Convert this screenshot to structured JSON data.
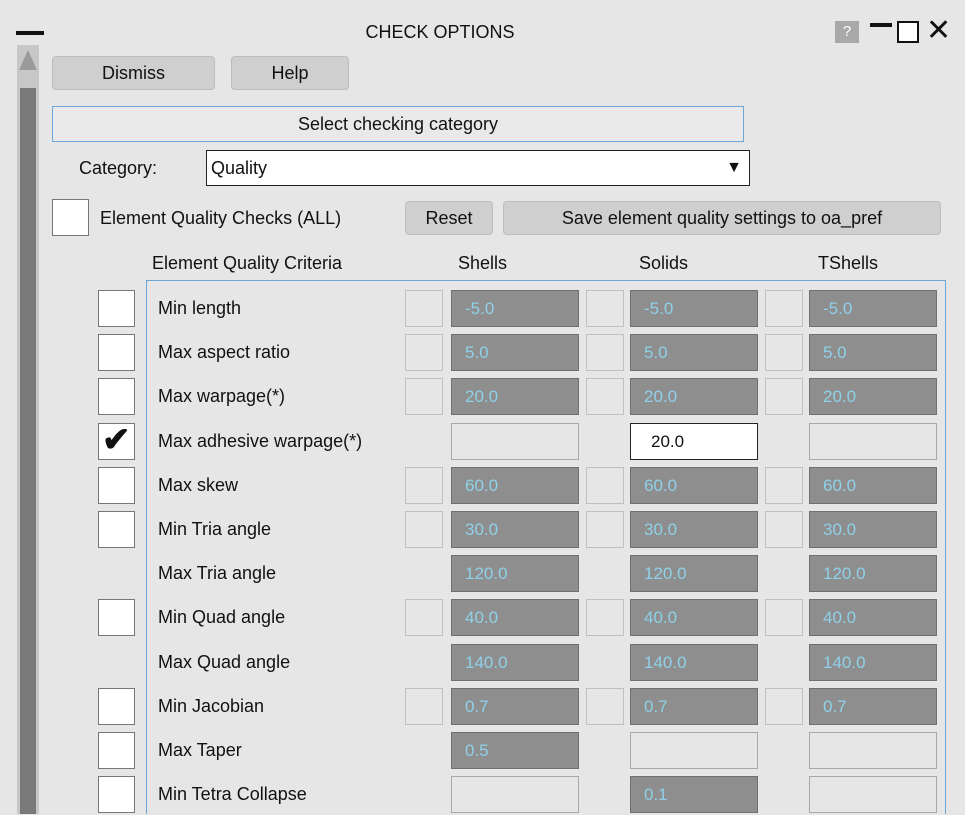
{
  "window": {
    "title": "CHECK OPTIONS",
    "help": "?"
  },
  "toolbar": {
    "dismiss": "Dismiss",
    "help": "Help"
  },
  "category": {
    "banner": "Select checking category",
    "label": "Category:",
    "value": "Quality"
  },
  "quality": {
    "all_label": "Element Quality Checks (ALL)",
    "reset": "Reset",
    "save": "Save element quality settings to oa_pref"
  },
  "columns": {
    "criteria": "Element Quality Criteria",
    "shells": "Shells",
    "solids": "Solids",
    "tshells": "TShells"
  },
  "rows": [
    {
      "label": "Min length",
      "checked": false,
      "has_check": true,
      "shells": {
        "value": "-5.0",
        "state": "disabled",
        "toggle": true
      },
      "solids": {
        "value": "-5.0",
        "state": "disabled",
        "toggle": true
      },
      "tshells": {
        "value": "-5.0",
        "state": "disabled",
        "toggle": true
      }
    },
    {
      "label": "Max aspect ratio",
      "checked": false,
      "has_check": true,
      "shells": {
        "value": "5.0",
        "state": "disabled",
        "toggle": true
      },
      "solids": {
        "value": "5.0",
        "state": "disabled",
        "toggle": true
      },
      "tshells": {
        "value": "5.0",
        "state": "disabled",
        "toggle": true
      }
    },
    {
      "label": "Max warpage(*)",
      "checked": false,
      "has_check": true,
      "shells": {
        "value": "20.0",
        "state": "disabled",
        "toggle": true
      },
      "solids": {
        "value": "20.0",
        "state": "disabled",
        "toggle": true
      },
      "tshells": {
        "value": "20.0",
        "state": "disabled",
        "toggle": true
      }
    },
    {
      "label": "Max adhesive warpage(*)",
      "checked": true,
      "has_check": true,
      "shells": {
        "value": "",
        "state": "empty",
        "toggle": false
      },
      "solids": {
        "value": "20.0",
        "state": "active",
        "toggle": false
      },
      "tshells": {
        "value": "",
        "state": "empty",
        "toggle": false
      }
    },
    {
      "label": "Max skew",
      "checked": false,
      "has_check": true,
      "shells": {
        "value": "60.0",
        "state": "disabled",
        "toggle": true
      },
      "solids": {
        "value": "60.0",
        "state": "disabled",
        "toggle": true
      },
      "tshells": {
        "value": "60.0",
        "state": "disabled",
        "toggle": true
      }
    },
    {
      "label": "Min Tria angle",
      "checked": false,
      "has_check": true,
      "shells": {
        "value": "30.0",
        "state": "disabled",
        "toggle": true
      },
      "solids": {
        "value": "30.0",
        "state": "disabled",
        "toggle": true
      },
      "tshells": {
        "value": "30.0",
        "state": "disabled",
        "toggle": true
      }
    },
    {
      "label": "Max Tria angle",
      "checked": false,
      "has_check": false,
      "shells": {
        "value": "120.0",
        "state": "disabled",
        "toggle": false
      },
      "solids": {
        "value": "120.0",
        "state": "disabled",
        "toggle": false
      },
      "tshells": {
        "value": "120.0",
        "state": "disabled",
        "toggle": false
      }
    },
    {
      "label": "Min Quad angle",
      "checked": false,
      "has_check": true,
      "shells": {
        "value": "40.0",
        "state": "disabled",
        "toggle": true
      },
      "solids": {
        "value": "40.0",
        "state": "disabled",
        "toggle": true
      },
      "tshells": {
        "value": "40.0",
        "state": "disabled",
        "toggle": true
      }
    },
    {
      "label": "Max Quad angle",
      "checked": false,
      "has_check": false,
      "shells": {
        "value": "140.0",
        "state": "disabled",
        "toggle": false
      },
      "solids": {
        "value": "140.0",
        "state": "disabled",
        "toggle": false
      },
      "tshells": {
        "value": "140.0",
        "state": "disabled",
        "toggle": false
      }
    },
    {
      "label": "Min Jacobian",
      "checked": false,
      "has_check": true,
      "shells": {
        "value": "0.7",
        "state": "disabled",
        "toggle": true
      },
      "solids": {
        "value": "0.7",
        "state": "disabled",
        "toggle": true
      },
      "tshells": {
        "value": "0.7",
        "state": "disabled",
        "toggle": true
      }
    },
    {
      "label": "Max Taper",
      "checked": false,
      "has_check": true,
      "shells": {
        "value": "0.5",
        "state": "disabled",
        "toggle": false
      },
      "solids": {
        "value": "",
        "state": "empty",
        "toggle": false
      },
      "tshells": {
        "value": "",
        "state": "empty",
        "toggle": false
      }
    },
    {
      "label": "Min Tetra Collapse",
      "checked": false,
      "has_check": true,
      "shells": {
        "value": "",
        "state": "empty",
        "toggle": false
      },
      "solids": {
        "value": "0.1",
        "state": "disabled",
        "toggle": false
      },
      "tshells": {
        "value": "",
        "state": "empty",
        "toggle": false
      }
    }
  ]
}
